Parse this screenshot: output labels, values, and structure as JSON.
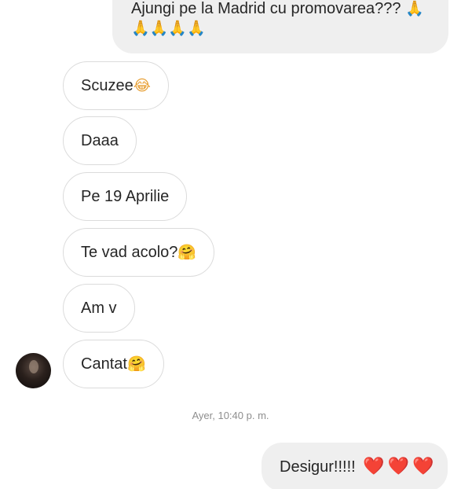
{
  "messages_outgoing": {
    "top": {
      "line1": "Ajungi pe la Madrid cu promovarea???",
      "line1_emoji": "🙏",
      "line2_emoji": [
        "🙏",
        "🙏",
        "🙏",
        "🙏"
      ]
    },
    "bottom": {
      "text": "Desigur!!!!!",
      "emoji": [
        "❤️",
        "❤️",
        "❤️"
      ]
    }
  },
  "messages_incoming": [
    {
      "text": "Scuzee",
      "emoji": "😂"
    },
    {
      "text": "Daaa",
      "emoji": ""
    },
    {
      "text": "Pe 19 Aprilie",
      "emoji": ""
    },
    {
      "text": "Te vad acolo?",
      "emoji": "🤗"
    },
    {
      "text": "Am v",
      "emoji": ""
    },
    {
      "text": "Cantat",
      "emoji": "🤗"
    }
  ],
  "timestamp": "Ayer, 10:40 p. m.",
  "colors": {
    "outgoing_bubble": "#efefef",
    "incoming_border": "#dbdbdb",
    "text": "#262626",
    "timestamp": "#8e8e8e"
  },
  "icons": {
    "avatar": "contact-avatar-photo"
  }
}
